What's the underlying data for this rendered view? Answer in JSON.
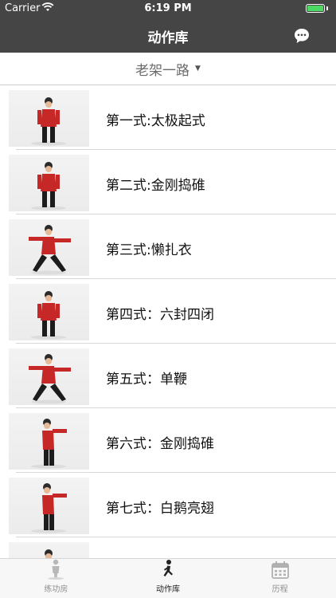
{
  "status_bar": {
    "carrier": "Carrier",
    "time": "6:19 PM"
  },
  "nav": {
    "title": "动作库"
  },
  "selector": {
    "value": "老架一路"
  },
  "moves": [
    {
      "label": "第一式:太极起式",
      "pose": "stand"
    },
    {
      "label": "第二式:金刚捣碓",
      "pose": "stand"
    },
    {
      "label": "第三式:懒扎衣",
      "pose": "wide"
    },
    {
      "label": "第四式：六封四闭",
      "pose": "stand"
    },
    {
      "label": "第五式：单鞭",
      "pose": "wide"
    },
    {
      "label": "第六式：金刚捣碓",
      "pose": "side"
    },
    {
      "label": "第七式：白鹅亮翅",
      "pose": "side"
    },
    {
      "label": "",
      "pose": "stand"
    }
  ],
  "tabs": [
    {
      "label": "练功房",
      "icon": "person-icon",
      "active": false
    },
    {
      "label": "动作库",
      "icon": "running-figure-icon",
      "active": true
    },
    {
      "label": "历程",
      "icon": "calendar-icon",
      "active": false
    }
  ],
  "colors": {
    "header_bg": "#454545",
    "accent_red": "#c62828",
    "battery": "#4cd964"
  }
}
